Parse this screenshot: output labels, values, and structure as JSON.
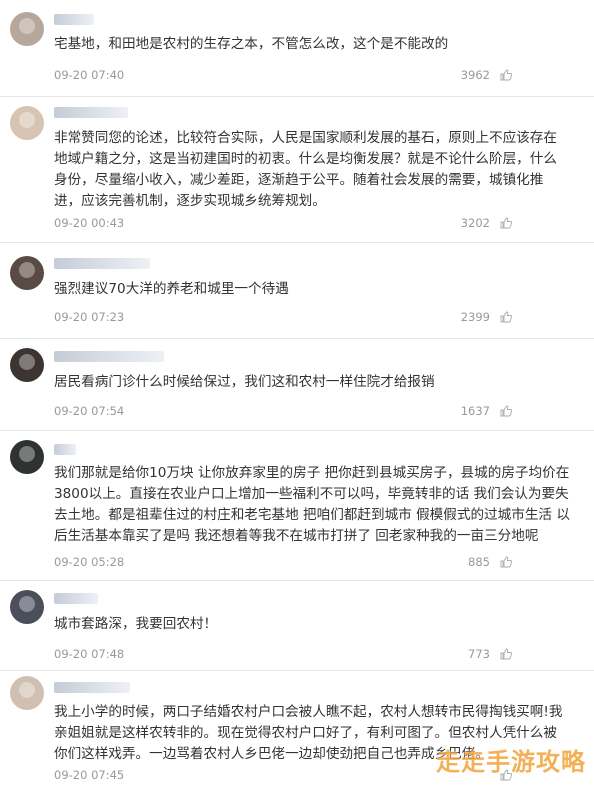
{
  "comments": [
    {
      "username": "",
      "text": "宅基地，和田地是农村的生存之本，不管怎么改，这个是不能改的",
      "time": "09-20 07:40",
      "likes": "3962"
    },
    {
      "username": "",
      "text": "非常赞同您的论述，比较符合实际，人民是国家顺利发展的基石，原则上不应该存在\n地域户籍之分，这是当初建国时的初衷。什么是均衡发展？就是不论什么阶层，什么\n身份，尽量缩小收入，减少差距，逐渐趋于公平。随着社会发展的需要，城镇化推\n进，应该完善机制，逐步实现城乡统筹规划。",
      "time": "09-20 00:43",
      "likes": "3202"
    },
    {
      "username": "",
      "text": "强烈建议70大洋的养老和城里一个待遇",
      "time": "09-20 07:23",
      "likes": "2399"
    },
    {
      "username": "",
      "text": "居民看病门诊什么时候给保过，我们这和农村一样住院才给报销",
      "time": "09-20 07:54",
      "likes": "1637"
    },
    {
      "username": "",
      "text": "我们那就是给你10万块 让你放弃家里的房子 把你赶到县城买房子，县城的房子均价在\n3800以上。直接在农业户口上增加一些福利不可以吗，毕竟转非的话 我们会认为要失\n去土地。都是祖辈住过的村庄和老宅基地 把咱们都赶到城市 假模假式的过城市生活 以\n后生活基本靠买了是吗 我还想着等我不在城市打拼了 回老家种我的一亩三分地呢",
      "time": "09-20 05:28",
      "likes": "885"
    },
    {
      "username": "",
      "text": "城市套路深，我要回农村！",
      "time": "09-20 07:48",
      "likes": "773"
    },
    {
      "username": "",
      "text": "我上小学的时候，两口子结婚农村户口会被人瞧不起，农村人想转市民得掏钱买啊!我\n亲姐姐就是这样农转非的。现在觉得农村户口好了，有利可图了。但农村人凭什么被\n你们这样戏弄。一边骂着农村人乡巴佬一边却使劲把自己也弄成乡巴佬。",
      "time": "09-20 07:45",
      "likes": ""
    }
  ],
  "watermark": "走走手游攻略",
  "colors": {
    "text": "#333333",
    "meta": "#999999",
    "divider": "#e6e6e6",
    "watermark": "#f2a33a"
  },
  "icons": {
    "like": "thumbs-up-icon"
  }
}
